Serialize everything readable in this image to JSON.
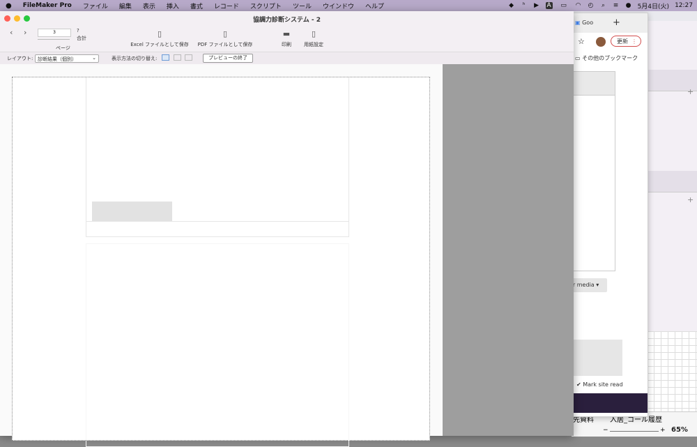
{
  "menubar": {
    "apple": "",
    "app_name": "FileMaker Pro",
    "items": [
      "ファイル",
      "編集",
      "表示",
      "挿入",
      "書式",
      "レコード",
      "スクリプト",
      "ツール",
      "ウインドウ",
      "ヘルプ"
    ],
    "clock_date": "5月4日(火)",
    "clock_time": "12:27"
  },
  "window": {
    "title": "協調力診断システム - 2",
    "page_number": "3",
    "total_label": "?",
    "total_caption": "合計",
    "page_caption": "ページ",
    "toolbar": {
      "excel_label": "Excel ファイルとして保存",
      "pdf_label": "PDF ファイルとして保存",
      "print_label": "印刷",
      "page_setup_label": "用紙設定"
    },
    "statusbar": {
      "layout_caption": "レイアウト:",
      "layout_value": "診断結果（個別）",
      "view_caption": "表示方法の切り替え:",
      "exit_preview_label": "プレビューの終了"
    }
  },
  "chrome": {
    "tab_title": "Goo",
    "new_tab": "+",
    "update_label": "更新",
    "bookmarks_label": "その他のブックマーク",
    "media_label": "er media ▾",
    "mark_read_label": "Mark site read"
  },
  "background": {
    "bottom_text_1": "先資料",
    "bottom_text_2": "入居_コール履歴",
    "zoom_minus": "−",
    "zoom_plus": "+",
    "zoom_value": "65%"
  },
  "colors": {
    "menubar": "#b7a9c9",
    "close": "#ff5f57",
    "minimize": "#febc2e",
    "zoom": "#28c840",
    "update_border": "#d24c4c"
  }
}
